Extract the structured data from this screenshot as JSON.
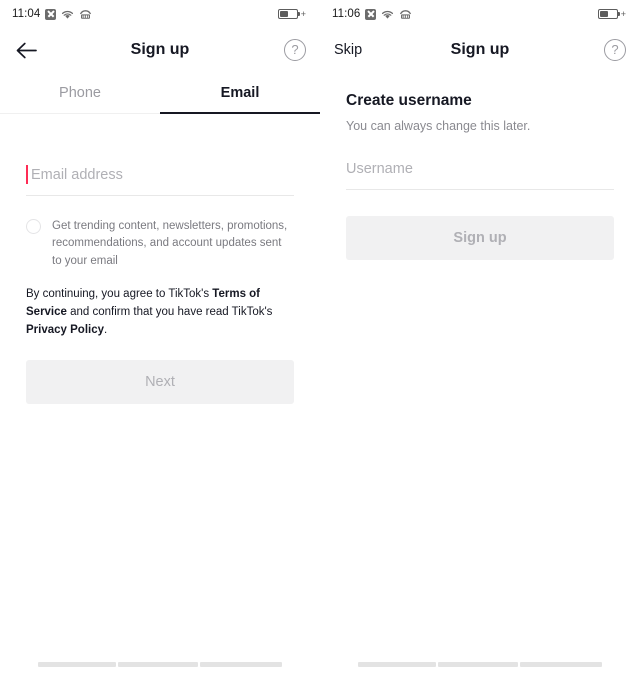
{
  "screens": [
    {
      "status_bar": {
        "time": "11:04",
        "icons": [
          "x-box-icon",
          "wifi-icon",
          "signal-icon"
        ],
        "battery": {
          "bolt": "+"
        }
      },
      "header": {
        "left_action": "back-arrow",
        "title": "Sign up",
        "right_action_label": "?"
      },
      "tabs": [
        {
          "label": "Phone",
          "active": false
        },
        {
          "label": "Email",
          "active": true
        }
      ],
      "form": {
        "email_placeholder": "Email address",
        "consent_text": "Get trending content, newsletters, promotions, recommendations, and account updates sent to your email",
        "terms": {
          "prefix": "By continuing, you agree to TikTok's ",
          "link1": "Terms of Service",
          "middle": " and confirm that you have read TikTok's ",
          "link2": "Privacy Policy",
          "suffix": "."
        },
        "submit_label": "Next"
      }
    },
    {
      "status_bar": {
        "time": "11:06",
        "icons": [
          "x-box-icon",
          "wifi-icon",
          "signal-icon"
        ],
        "battery": {
          "bolt": "+"
        }
      },
      "header": {
        "left_action_label": "Skip",
        "title": "Sign up",
        "right_action_label": "?"
      },
      "form": {
        "heading": "Create username",
        "subtitle": "You can always change this later.",
        "username_placeholder": "Username",
        "submit_label": "Sign up"
      }
    }
  ],
  "colors": {
    "accent_red": "#FE2C55",
    "text_primary": "#161823",
    "text_muted": "#8A8A90",
    "disabled_button_bg": "#F1F1F2",
    "disabled_button_text": "#B0B0B5"
  }
}
